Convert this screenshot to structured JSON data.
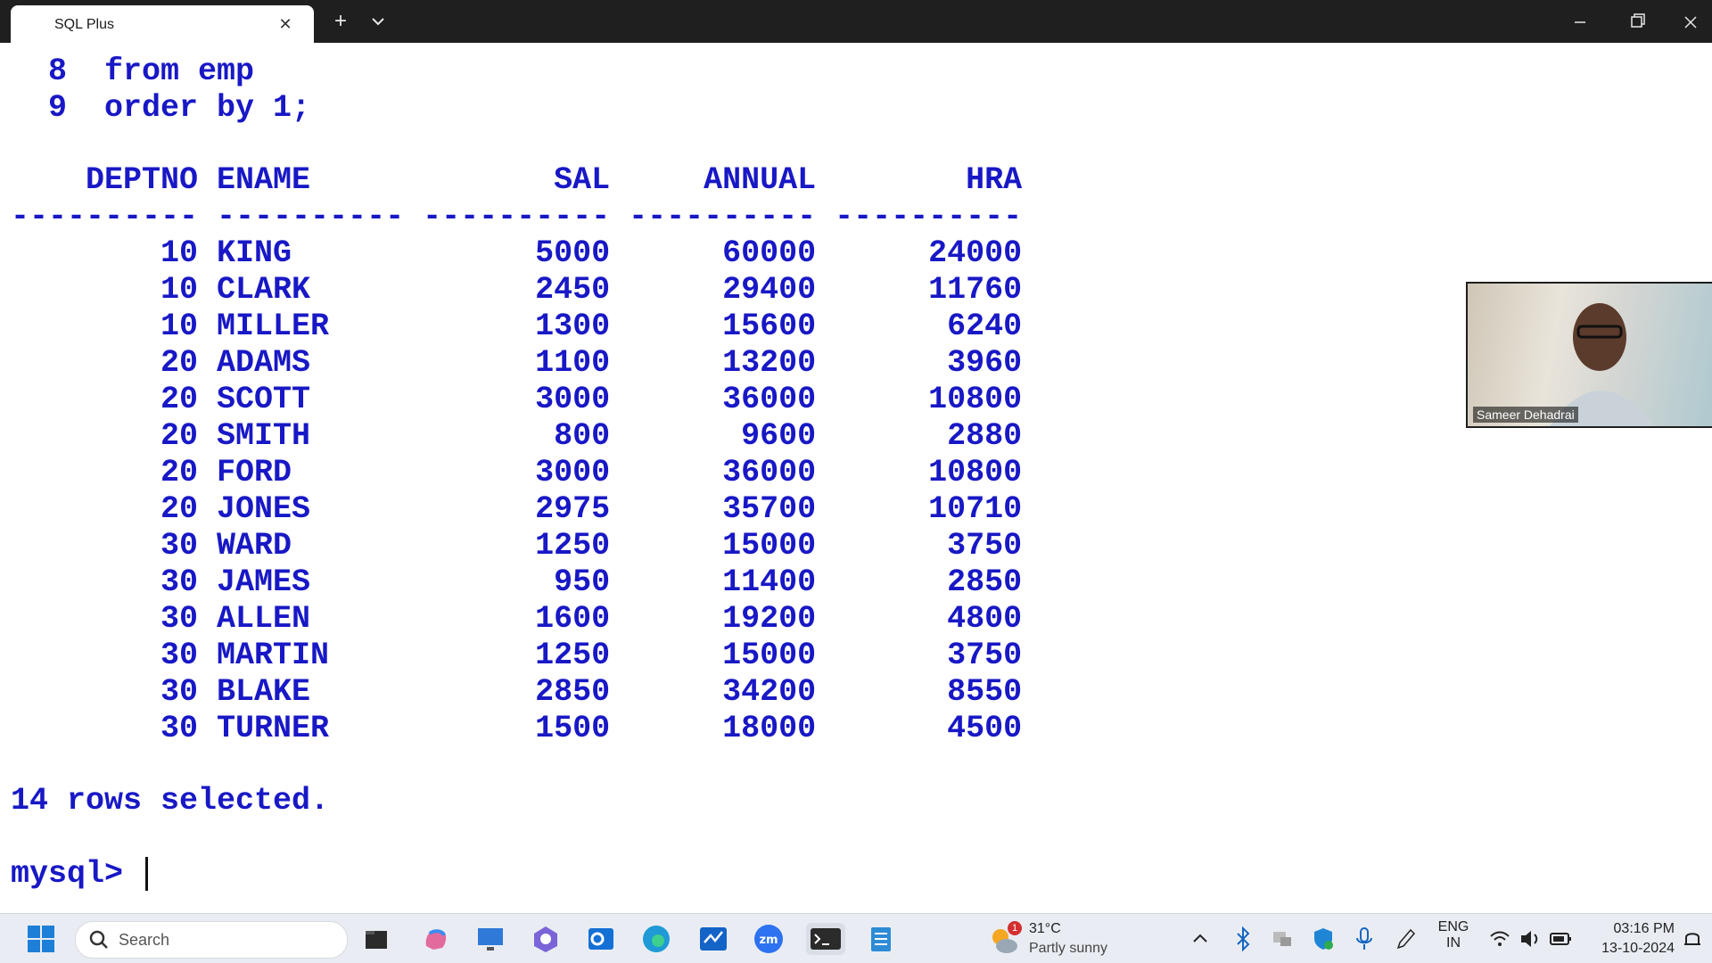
{
  "window": {
    "tab_title": "SQL Plus",
    "tab_close": "✕",
    "new_tab": "+"
  },
  "terminal": {
    "code_lines": "  8  from emp\n  9  order by 1;",
    "results_block": "    DEPTNO ENAME             SAL     ANNUAL        HRA\n---------- ---------- ---------- ---------- ----------\n        10 KING             5000      60000      24000\n        10 CLARK            2450      29400      11760\n        10 MILLER           1300      15600       6240\n        20 ADAMS            1100      13200       3960\n        20 SCOTT            3000      36000      10800\n        20 SMITH             800       9600       2880\n        20 FORD             3000      36000      10800\n        20 JONES            2975      35700      10710\n        30 WARD             1250      15000       3750\n        30 JAMES             950      11400       2850\n        30 ALLEN            1600      19200       4800\n        30 MARTIN           1250      15000       3750\n        30 BLAKE            2850      34200       8550\n        30 TURNER           1500      18000       4500",
    "rows_selected": "14 rows selected.",
    "prompt": "mysql> "
  },
  "video": {
    "participant_name": "Sameer Dehadrai"
  },
  "taskbar": {
    "search_placeholder": "Search",
    "weather_temp": "31°C",
    "weather_desc": "Partly sunny",
    "weather_badge": "1",
    "language_top": "ENG",
    "language_bottom": "IN",
    "time": "03:16 PM",
    "date": "13-10-2024",
    "icons": [
      "windows-start-icon",
      "search-icon",
      "file-explorer-icon",
      "copilot-icon",
      "remote-desktop-icon",
      "teams-icon",
      "outlook-icon",
      "edge-icon",
      "whiteboard-icon",
      "zoom-icon",
      "terminal-icon",
      "notepad-icon"
    ]
  },
  "colors": {
    "terminal_text": "#1818c6",
    "titlebar": "#1f1f1f",
    "taskbar": "#e9edf3"
  }
}
